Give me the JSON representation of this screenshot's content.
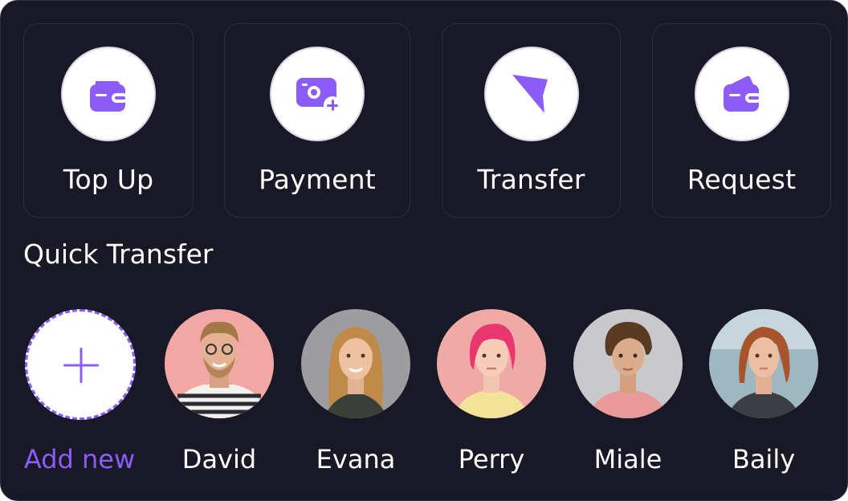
{
  "actions": [
    {
      "label": "Top Up",
      "icon": "wallet-icon"
    },
    {
      "label": "Payment",
      "icon": "money-add-icon"
    },
    {
      "label": "Transfer",
      "icon": "send-arrow-icon"
    },
    {
      "label": "Request",
      "icon": "wallet-request-icon"
    }
  ],
  "quick_transfer": {
    "title": "Quick Transfer",
    "add_label": "Add new",
    "contacts": [
      {
        "name": "David"
      },
      {
        "name": "Evana"
      },
      {
        "name": "Perry"
      },
      {
        "name": "Miale"
      },
      {
        "name": "Baily"
      }
    ]
  },
  "colors": {
    "background": "#181827",
    "accent": "#8b5cf6",
    "card_border": "#2d2d41",
    "text": "#ffffff"
  }
}
